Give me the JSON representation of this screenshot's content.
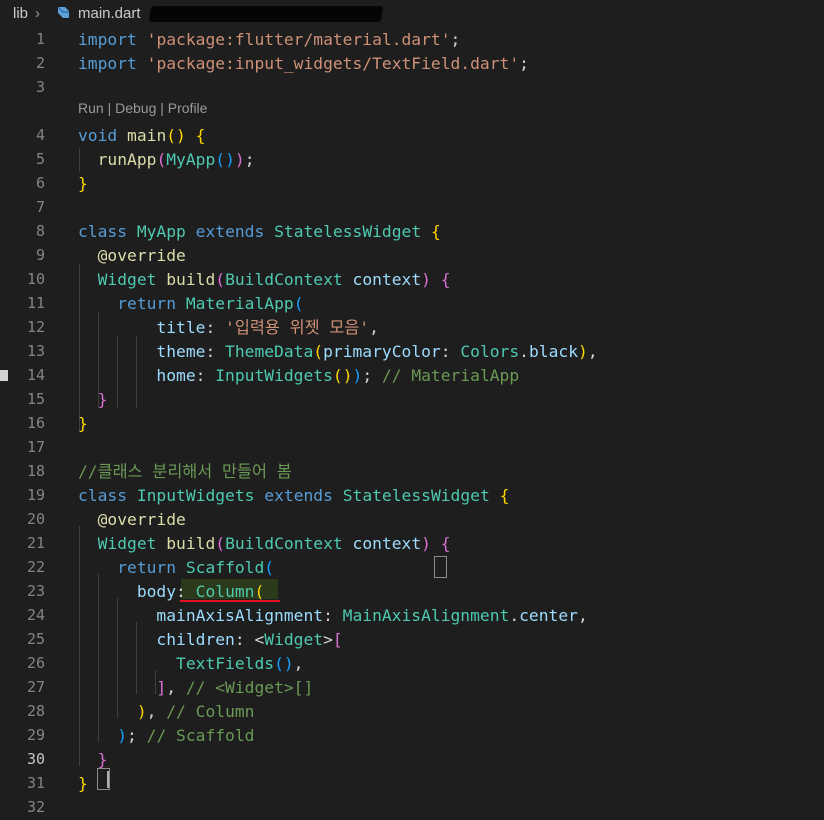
{
  "breadcrumb": {
    "folder": "lib",
    "separator": "›",
    "file": "main.dart"
  },
  "codelens": "Run | Debug | Profile",
  "editor": {
    "current_line": 30,
    "lines": [
      {
        "n": "1",
        "tokens": [
          [
            "k",
            "import"
          ],
          [
            "p",
            " "
          ],
          [
            "s",
            "'package:flutter/material.dart'"
          ],
          [
            "p",
            ";"
          ]
        ]
      },
      {
        "n": "2",
        "tokens": [
          [
            "k",
            "import"
          ],
          [
            "p",
            " "
          ],
          [
            "s",
            "'package:input_widgets/TextField.dart'"
          ],
          [
            "p",
            ";"
          ]
        ]
      },
      {
        "n": "3",
        "tokens": []
      },
      {
        "n": "4",
        "tokens": [
          [
            "k",
            "void"
          ],
          [
            "p",
            " "
          ],
          [
            "f",
            "main"
          ],
          [
            "b1",
            "()"
          ],
          [
            "p",
            " "
          ],
          [
            "b1",
            "{"
          ]
        ]
      },
      {
        "n": "5",
        "tokens": [
          [
            "p",
            "  "
          ],
          [
            "f",
            "runApp"
          ],
          [
            "b2",
            "("
          ],
          [
            "c",
            "MyApp"
          ],
          [
            "b3",
            "()"
          ],
          [
            "b2",
            ")"
          ],
          [
            "p",
            ";"
          ]
        ]
      },
      {
        "n": "6",
        "tokens": [
          [
            "b1",
            "}"
          ]
        ]
      },
      {
        "n": "7",
        "tokens": []
      },
      {
        "n": "8",
        "tokens": [
          [
            "k",
            "class"
          ],
          [
            "p",
            " "
          ],
          [
            "c",
            "MyApp"
          ],
          [
            "p",
            " "
          ],
          [
            "k",
            "extends"
          ],
          [
            "p",
            " "
          ],
          [
            "c",
            "StatelessWidget"
          ],
          [
            "p",
            " "
          ],
          [
            "b1",
            "{"
          ]
        ]
      },
      {
        "n": "9",
        "tokens": [
          [
            "p",
            "  "
          ],
          [
            "f",
            "@override"
          ]
        ]
      },
      {
        "n": "10",
        "tokens": [
          [
            "p",
            "  "
          ],
          [
            "c",
            "Widget"
          ],
          [
            "p",
            " "
          ],
          [
            "f",
            "build"
          ],
          [
            "b2",
            "("
          ],
          [
            "c",
            "BuildContext"
          ],
          [
            "p",
            " "
          ],
          [
            "v",
            "context"
          ],
          [
            "b2",
            ")"
          ],
          [
            "p",
            " "
          ],
          [
            "b2",
            "{"
          ]
        ]
      },
      {
        "n": "11",
        "tokens": [
          [
            "p",
            "    "
          ],
          [
            "k",
            "return"
          ],
          [
            "p",
            " "
          ],
          [
            "c",
            "MaterialApp"
          ],
          [
            "b3",
            "("
          ]
        ]
      },
      {
        "n": "12",
        "tokens": [
          [
            "p",
            "        "
          ],
          [
            "v",
            "title"
          ],
          [
            "p",
            ": "
          ],
          [
            "s",
            "'입력용 위젯 모음'"
          ],
          [
            "p",
            ","
          ]
        ]
      },
      {
        "n": "13",
        "tokens": [
          [
            "p",
            "        "
          ],
          [
            "v",
            "theme"
          ],
          [
            "p",
            ": "
          ],
          [
            "c",
            "ThemeData"
          ],
          [
            "b1",
            "("
          ],
          [
            "v",
            "primaryColor"
          ],
          [
            "p",
            ": "
          ],
          [
            "c",
            "Colors"
          ],
          [
            "p",
            "."
          ],
          [
            "v",
            "black"
          ],
          [
            "b1",
            ")"
          ],
          [
            "p",
            ","
          ]
        ]
      },
      {
        "n": "14",
        "tokens": [
          [
            "p",
            "        "
          ],
          [
            "v",
            "home"
          ],
          [
            "p",
            ": "
          ],
          [
            "c",
            "InputWidgets"
          ],
          [
            "b1",
            "()"
          ],
          [
            "b3",
            ")"
          ],
          [
            "p",
            "; "
          ],
          [
            "m",
            "// MaterialApp"
          ]
        ]
      },
      {
        "n": "15",
        "tokens": [
          [
            "p",
            "  "
          ],
          [
            "b2",
            "}"
          ]
        ]
      },
      {
        "n": "16",
        "tokens": [
          [
            "b1",
            "}"
          ]
        ]
      },
      {
        "n": "17",
        "tokens": []
      },
      {
        "n": "18",
        "tokens": [
          [
            "m",
            "//클래스 분리해서 만들어 봄"
          ]
        ]
      },
      {
        "n": "19",
        "tokens": [
          [
            "k",
            "class"
          ],
          [
            "p",
            " "
          ],
          [
            "c",
            "InputWidgets"
          ],
          [
            "p",
            " "
          ],
          [
            "k",
            "extends"
          ],
          [
            "p",
            " "
          ],
          [
            "c",
            "StatelessWidget"
          ],
          [
            "p",
            " "
          ],
          [
            "b1",
            "{"
          ]
        ]
      },
      {
        "n": "20",
        "tokens": [
          [
            "p",
            "  "
          ],
          [
            "f",
            "@override"
          ]
        ]
      },
      {
        "n": "21",
        "tokens": [
          [
            "p",
            "  "
          ],
          [
            "c",
            "Widget"
          ],
          [
            "p",
            " "
          ],
          [
            "f",
            "build"
          ],
          [
            "b2",
            "("
          ],
          [
            "c",
            "BuildContext"
          ],
          [
            "p",
            " "
          ],
          [
            "v",
            "context"
          ],
          [
            "b2",
            ")"
          ],
          [
            "p",
            " "
          ],
          [
            "b2",
            "{"
          ]
        ]
      },
      {
        "n": "22",
        "tokens": [
          [
            "p",
            "    "
          ],
          [
            "k",
            "return"
          ],
          [
            "p",
            " "
          ],
          [
            "scaffold",
            "Scaffold"
          ],
          [
            "b3",
            "("
          ]
        ]
      },
      {
        "n": "23",
        "tokens": [
          [
            "p",
            "      "
          ],
          [
            "v",
            "body"
          ],
          [
            "p",
            ": "
          ],
          [
            "c",
            "Column"
          ],
          [
            "b1",
            "("
          ]
        ]
      },
      {
        "n": "24",
        "tokens": [
          [
            "p",
            "        "
          ],
          [
            "v",
            "mainAxisAlignment"
          ],
          [
            "p",
            ": "
          ],
          [
            "c",
            "MainAxisAlignment"
          ],
          [
            "p",
            "."
          ],
          [
            "v",
            "center"
          ],
          [
            "p",
            ","
          ]
        ]
      },
      {
        "n": "25",
        "tokens": [
          [
            "p",
            "        "
          ],
          [
            "v",
            "children"
          ],
          [
            "p",
            ": <"
          ],
          [
            "c",
            "Widget"
          ],
          [
            "p",
            ">"
          ],
          [
            "b2",
            "["
          ]
        ]
      },
      {
        "n": "26",
        "tokens": [
          [
            "p",
            "          "
          ],
          [
            "c",
            "TextFields"
          ],
          [
            "b3",
            "()"
          ],
          [
            "p",
            ","
          ]
        ]
      },
      {
        "n": "27",
        "tokens": [
          [
            "p",
            "        "
          ],
          [
            "b2",
            "]"
          ],
          [
            "p",
            ", "
          ],
          [
            "m",
            "// <Widget>[]"
          ]
        ]
      },
      {
        "n": "28",
        "tokens": [
          [
            "p",
            "      "
          ],
          [
            "b1",
            ")"
          ],
          [
            "p",
            ", "
          ],
          [
            "m",
            "// Column"
          ]
        ]
      },
      {
        "n": "29",
        "tokens": [
          [
            "p",
            "    "
          ],
          [
            "b3",
            ")"
          ],
          [
            "p",
            "; "
          ],
          [
            "m",
            "// Scaffold"
          ]
        ]
      },
      {
        "n": "30",
        "tokens": [
          [
            "p",
            "  "
          ],
          [
            "b2",
            "}"
          ]
        ]
      },
      {
        "n": "31",
        "tokens": [
          [
            "b1",
            "}"
          ]
        ]
      },
      {
        "n": "32",
        "tokens": []
      }
    ]
  }
}
